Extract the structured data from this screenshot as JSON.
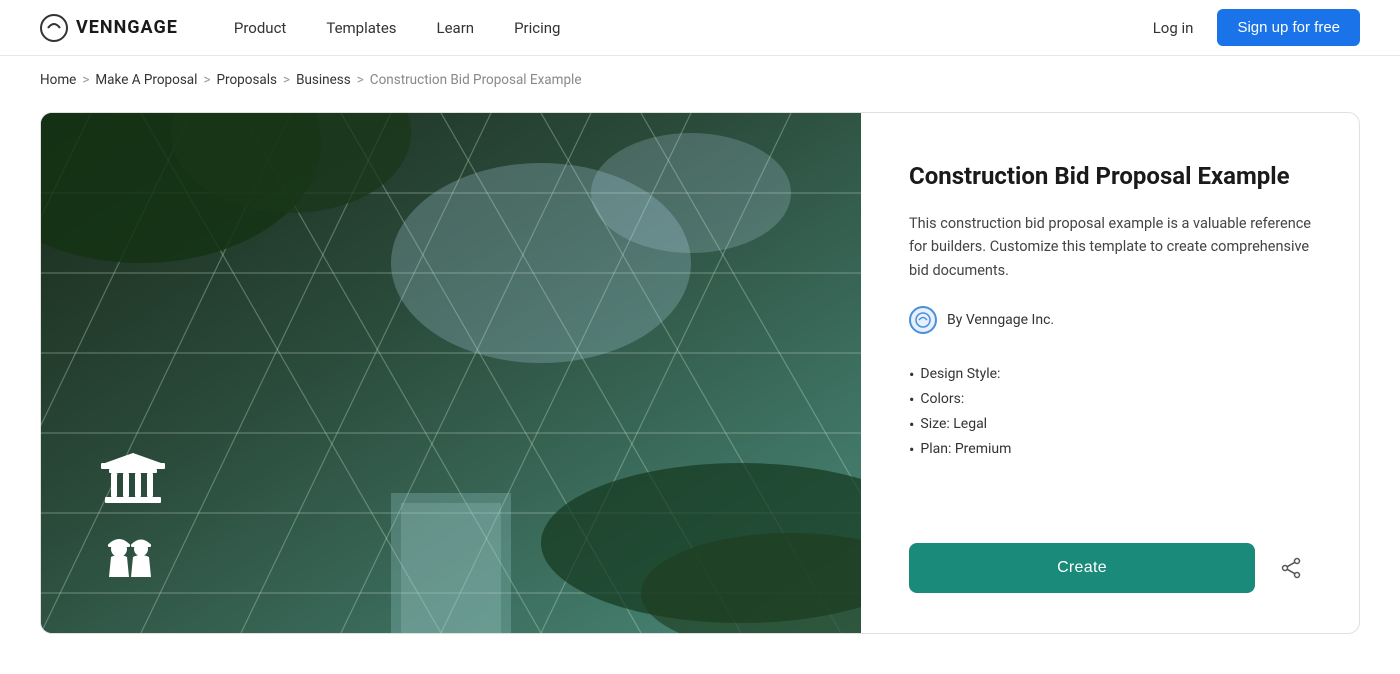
{
  "brand": {
    "name": "VENNGAGE",
    "logo_alt": "Venngage logo"
  },
  "nav": {
    "items": [
      {
        "label": "Product",
        "id": "product"
      },
      {
        "label": "Templates",
        "id": "templates"
      },
      {
        "label": "Learn",
        "id": "learn"
      },
      {
        "label": "Pricing",
        "id": "pricing"
      }
    ],
    "login_label": "Log in",
    "signup_label": "Sign up for free"
  },
  "breadcrumb": {
    "items": [
      {
        "label": "Home"
      },
      {
        "label": "Make A Proposal"
      },
      {
        "label": "Proposals"
      },
      {
        "label": "Business"
      }
    ],
    "current": "Construction Bid Proposal Example"
  },
  "template": {
    "title": "Construction Bid Proposal Example",
    "description": "This construction bid proposal example is a valuable reference for builders. Customize this template to create comprehensive bid documents.",
    "author": "By Venngage Inc.",
    "meta": [
      {
        "label": "Design Style:"
      },
      {
        "label": "Colors:"
      },
      {
        "label": "Size: Legal"
      },
      {
        "label": "Plan: Premium"
      }
    ],
    "create_label": "Create",
    "share_icon": "share"
  }
}
